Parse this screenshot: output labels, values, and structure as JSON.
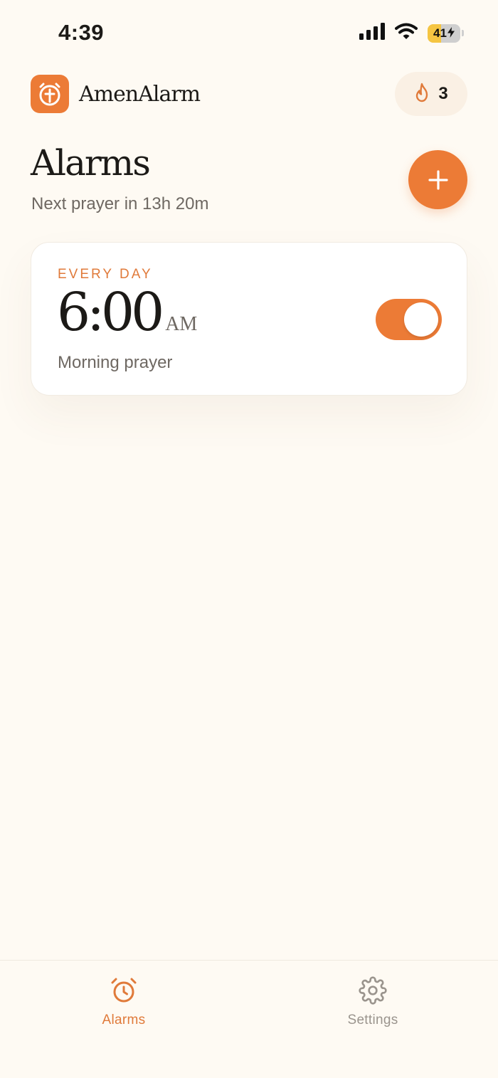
{
  "status_bar": {
    "time": "4:39",
    "battery_level": "41",
    "battery_fraction": 0.41,
    "icons": [
      "signal-icon",
      "wifi-icon",
      "battery-icon",
      "charging-bolt-icon"
    ]
  },
  "header": {
    "app_name": "AmenAlarm",
    "logo_icon": "alarm-cross-icon",
    "streak_icon": "flame-icon",
    "streak_count": "3"
  },
  "main": {
    "title": "Alarms",
    "subtitle": "Next prayer in 13h 20m",
    "add_icon": "plus-icon"
  },
  "alarms": [
    {
      "repeat": "EVERY DAY",
      "time": "6:00",
      "period": "AM",
      "label": "Morning prayer",
      "enabled": true
    }
  ],
  "tab_bar": {
    "tabs": [
      {
        "label": "Alarms",
        "icon": "alarm-clock-icon",
        "active": true
      },
      {
        "label": "Settings",
        "icon": "gear-icon",
        "active": false
      }
    ]
  },
  "colors": {
    "accent": "#EC7B36",
    "background": "#FEFAF3",
    "card": "#FFFFFF",
    "muted_text": "#6E6862",
    "inactive_tab": "#9A948D"
  }
}
